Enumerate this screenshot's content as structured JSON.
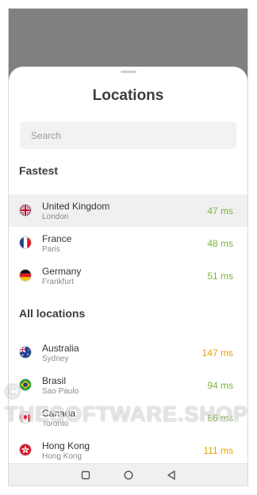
{
  "sheet": {
    "title": "Locations",
    "search_placeholder": "Search"
  },
  "fastest": {
    "heading": "Fastest",
    "items": [
      {
        "country": "United Kingdom",
        "city": "London",
        "latency": "47 ms",
        "flag": "uk-flag-icon",
        "selected": true
      },
      {
        "country": "France",
        "city": "Paris",
        "latency": "48 ms",
        "flag": "france-flag-icon"
      },
      {
        "country": "Germany",
        "city": "Frankfurt",
        "latency": "51 ms",
        "flag": "germany-flag-icon"
      }
    ]
  },
  "all_locations": {
    "heading": "All locations",
    "items": [
      {
        "country": "Australia",
        "city": "Sydney",
        "latency": "147 ms",
        "flag": "australia-flag-icon"
      },
      {
        "country": "Brasil",
        "city": "Sao Paulo",
        "latency": "94 ms",
        "flag": "brazil-flag-icon"
      },
      {
        "country": "Canada",
        "city": "Toronto",
        "latency": "86 ms",
        "flag": "canada-flag-icon"
      },
      {
        "country": "Hong Kong",
        "city": "Hong Kong",
        "latency": "111 ms",
        "flag": "hong-kong-flag-icon"
      }
    ]
  },
  "navigation": {
    "buttons": [
      "recent-apps-icon",
      "home-icon",
      "back-icon"
    ]
  },
  "watermark": {
    "text": "© THESOFTWARE.SHOP"
  },
  "colors": {
    "latency_good": "#7cb342",
    "latency_slow": "#e0a400",
    "overlay": "#808080"
  }
}
